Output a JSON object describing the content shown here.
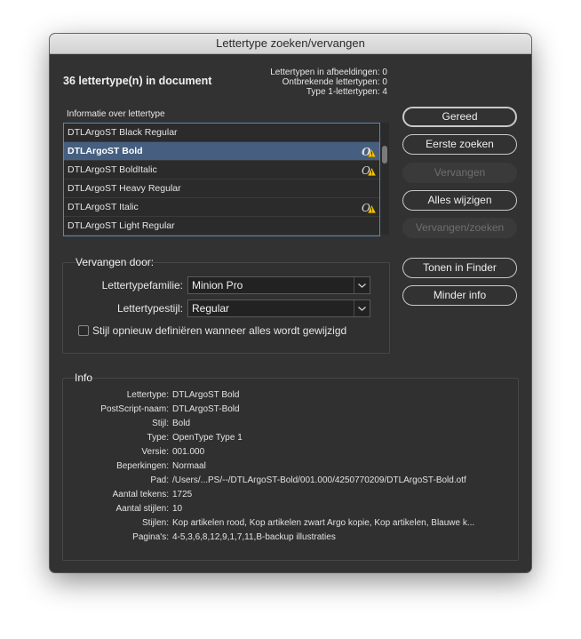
{
  "window": {
    "title": "Lettertype zoeken/vervangen"
  },
  "summary": {
    "doc_count": "36 lettertype(n) in document",
    "stats": [
      "Lettertypen in afbeeldingen: 0",
      "Ontbrekende lettertypen: 0",
      "Type 1-lettertypen: 4"
    ]
  },
  "font_list": {
    "label": "Informatie over lettertype",
    "items": [
      {
        "label": "DTLArgoST Black Regular",
        "warn": false
      },
      {
        "label": "DTLArgoST Bold",
        "warn": true,
        "selected": true
      },
      {
        "label": "DTLArgoST BoldItalic",
        "warn": true
      },
      {
        "label": "DTLArgoST Heavy Regular",
        "warn": false
      },
      {
        "label": "DTLArgoST Italic",
        "warn": true
      },
      {
        "label": "DTLArgoST Light Regular",
        "warn": false
      }
    ]
  },
  "buttons": {
    "done": "Gereed",
    "find_first": "Eerste zoeken",
    "replace": "Vervangen",
    "change_all": "Alles wijzigen",
    "replace_find": "Vervangen/zoeken",
    "show_finder": "Tonen in Finder",
    "less_info": "Minder info"
  },
  "replace_with": {
    "title": "Vervangen door:",
    "family_label": "Lettertypefamilie:",
    "family_value": "Minion Pro",
    "style_label": "Lettertypestijl:",
    "style_value": "Regular",
    "redefine_label": "Stijl opnieuw definiëren wanneer alles wordt gewijzigd",
    "redefine_checked": false
  },
  "info": {
    "title": "Info",
    "rows": [
      {
        "key": "Lettertype:",
        "value": "DTLArgoST Bold"
      },
      {
        "key": "PostScript-naam:",
        "value": "DTLArgoST-Bold"
      },
      {
        "key": "Stijl:",
        "value": "Bold"
      },
      {
        "key": "Type:",
        "value": "OpenType Type 1"
      },
      {
        "key": "Versie:",
        "value": "001.000"
      },
      {
        "key": "Beperkingen:",
        "value": "Normaal"
      },
      {
        "key": "Pad:",
        "value": "/Users/...PS/--/DTLArgoST-Bold/001.000/4250770209/DTLArgoST-Bold.otf"
      },
      {
        "key": "Aantal tekens:",
        "value": "1725"
      },
      {
        "key": "Aantal stijlen:",
        "value": "10"
      },
      {
        "key": "Stijlen:",
        "value": "Kop artikelen rood, Kop artikelen zwart Argo kopie, Kop artikelen, Blauwe k..."
      },
      {
        "key": "Pagina's:",
        "value": "4-5,3,6,8,12,9,1,7,11,B-backup illustraties"
      }
    ]
  },
  "colors": {
    "dialog_bg": "#323232",
    "selection": "#465f80",
    "list_border": "#5f86b8",
    "warning": "#f5c400"
  },
  "icons": {
    "warn": "opentype-warning-icon",
    "chevron": "chevron-down-icon"
  }
}
